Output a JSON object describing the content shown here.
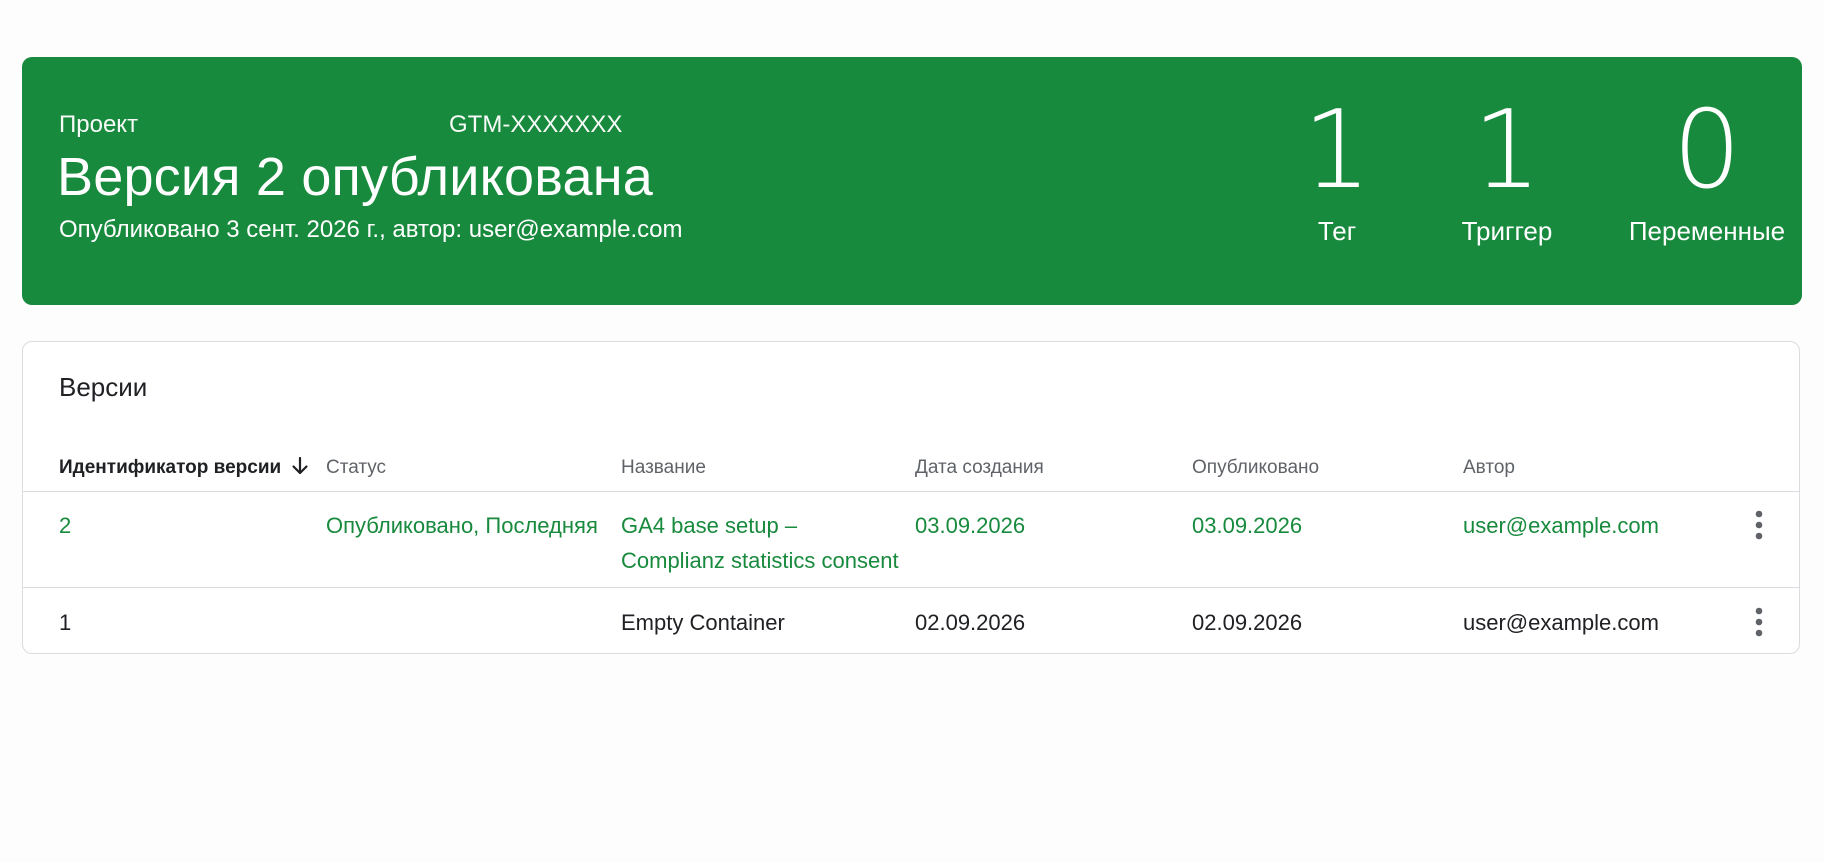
{
  "banner": {
    "project_label": "Проект",
    "container_id": "GTM-XXXXXXX",
    "title": "Версия 2 опубликована",
    "subtitle": "Опубликовано 3 сент. 2026 г., автор: user@example.com",
    "background_color": "#188a3d",
    "stats": {
      "tags": {
        "value": "1",
        "label": "Тег"
      },
      "triggers": {
        "value": "1",
        "label": "Триггер"
      },
      "variables": {
        "value": "0",
        "label": "Переменные"
      }
    }
  },
  "versions": {
    "title": "Версии",
    "columns": {
      "id": "Идентификатор версии",
      "status": "Статус",
      "name": "Название",
      "created": "Дата создания",
      "published": "Опубликовано",
      "author": "Автор"
    },
    "sort_icon": "arrow-down-icon",
    "rows": [
      {
        "id": "2",
        "status": "Опубликовано, Последняя",
        "name": "GA4 base setup – Complianz statistics consent",
        "created": "03.09.2026",
        "published": "03.09.2026",
        "author": "user@example.com",
        "menu_icon": "more-vert-icon",
        "highlight_color": "#188a3d"
      },
      {
        "id": "1",
        "status": "",
        "name": "Empty Container",
        "created": "02.09.2026",
        "published": "02.09.2026",
        "author": "user@example.com",
        "menu_icon": "more-vert-icon"
      }
    ]
  }
}
